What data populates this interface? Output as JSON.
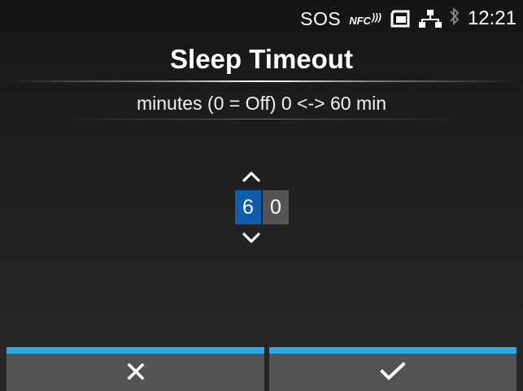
{
  "status": {
    "sos": "SOS",
    "nfc": "NFC",
    "time": "12:21",
    "icons": [
      "nfc-icon",
      "sd-card-icon",
      "network-icon",
      "bluetooth-icon"
    ]
  },
  "title": "Sleep Timeout",
  "subtitle": "minutes (0 = Off) 0 <-> 60 min",
  "value": {
    "digits": [
      "6",
      "0"
    ],
    "active_digit_index": 0,
    "min": 0,
    "max": 60,
    "unit": "min"
  },
  "buttons": {
    "cancel_icon": "close-icon",
    "confirm_icon": "checkmark-icon"
  },
  "colors": {
    "accent": "#27a9e1",
    "active_digit": "#0f5dae",
    "inactive_digit": "#545454",
    "button": "#535353",
    "background": "#1f1f1f"
  }
}
